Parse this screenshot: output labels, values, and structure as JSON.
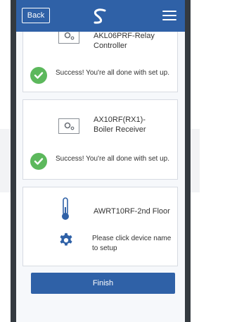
{
  "header": {
    "back_label": "Back",
    "logo": "swirl-logo",
    "menu_icon": "hamburger-menu-icon"
  },
  "devices": [
    {
      "name": "AKL06PRF-Relay Controller",
      "icon": "relay-device-icon",
      "status": "Success! You're all done with set up.",
      "status_icon": "check-circle-icon"
    },
    {
      "name": "AX10RF(RX1)-Boiler Receiver",
      "icon": "receiver-device-icon",
      "status": "Success! You're all done with set up.",
      "status_icon": "check-circle-icon"
    },
    {
      "name": "AWRT10RF-2nd Floor",
      "icon": "thermometer-icon",
      "status": "Please click device name to setup",
      "status_icon": "gear-icon"
    }
  ],
  "footer": {
    "finish_label": "Finish"
  },
  "colors": {
    "primary": "#2f61a7",
    "success": "#5cb85c",
    "card_border": "#d7dbe2"
  }
}
